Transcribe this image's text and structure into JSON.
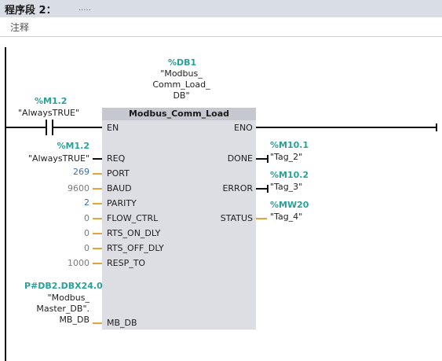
{
  "header": {
    "title": "程序段 2：",
    "dots": "....."
  },
  "comment": "注释",
  "db": {
    "address": "%DB1",
    "name_lines": [
      "\"Modbus_",
      "Comm_Load_",
      "DB\""
    ]
  },
  "contact": {
    "address": "%M1.2",
    "tag": "\"AlwaysTRUE\""
  },
  "block": {
    "title": "Modbus_Comm_Load",
    "en": "EN",
    "eno": "ENO",
    "inputs": [
      {
        "pin": "REQ",
        "address": "%M1.2",
        "value": "\"AlwaysTRUE\""
      },
      {
        "pin": "PORT",
        "value": "269"
      },
      {
        "pin": "BAUD",
        "value": "9600"
      },
      {
        "pin": "PARITY",
        "value": "2"
      },
      {
        "pin": "FLOW_CTRL",
        "value": "0"
      },
      {
        "pin": "RTS_ON_DLY",
        "value": "0"
      },
      {
        "pin": "RTS_OFF_DLY",
        "value": "0"
      },
      {
        "pin": "RESP_TO",
        "value": "1000"
      },
      {
        "pin": "MB_DB",
        "address": "P#DB2.DBX24.0",
        "value_lines": [
          "\"Modbus_",
          "Master_DB\".",
          "MB_DB"
        ]
      }
    ],
    "outputs": [
      {
        "pin": "DONE",
        "address": "%M10.1",
        "value": "\"Tag_2\""
      },
      {
        "pin": "ERROR",
        "address": "%M10.2",
        "value": "\"Tag_3\""
      },
      {
        "pin": "STATUS",
        "address": "%MW20",
        "value": "\"Tag_4\""
      }
    ]
  }
}
